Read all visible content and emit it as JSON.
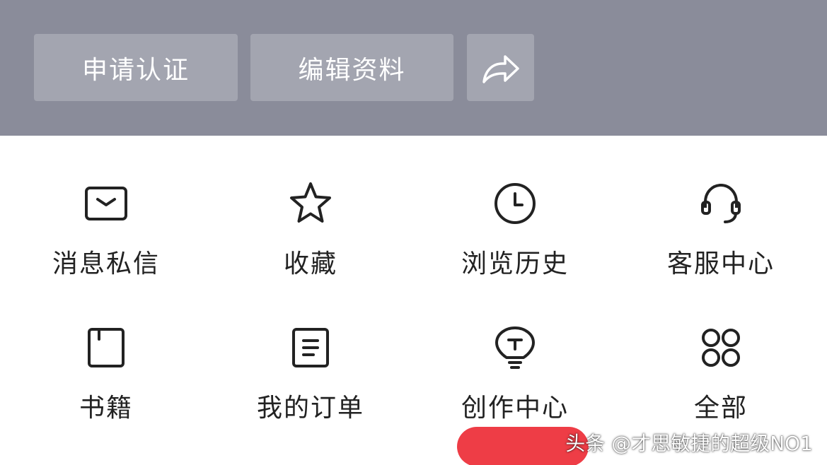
{
  "header": {
    "background_color": "#8a8c9a",
    "verify_label": "申请认证",
    "edit_label": "编辑资料",
    "share_icon": "share-icon"
  },
  "grid": {
    "items": [
      {
        "label": "消息私信",
        "icon": "mail-icon"
      },
      {
        "label": "收藏",
        "icon": "star-icon"
      },
      {
        "label": "浏览历史",
        "icon": "clock-icon"
      },
      {
        "label": "客服中心",
        "icon": "headset-icon"
      },
      {
        "label": "书籍",
        "icon": "book-icon"
      },
      {
        "label": "我的订单",
        "icon": "order-icon"
      },
      {
        "label": "创作中心",
        "icon": "bulb-icon"
      },
      {
        "label": "全部",
        "icon": "grid-icon"
      }
    ]
  },
  "accent_color": "#ee3d46",
  "watermark": "头条 @才思敏捷的超级NO1"
}
